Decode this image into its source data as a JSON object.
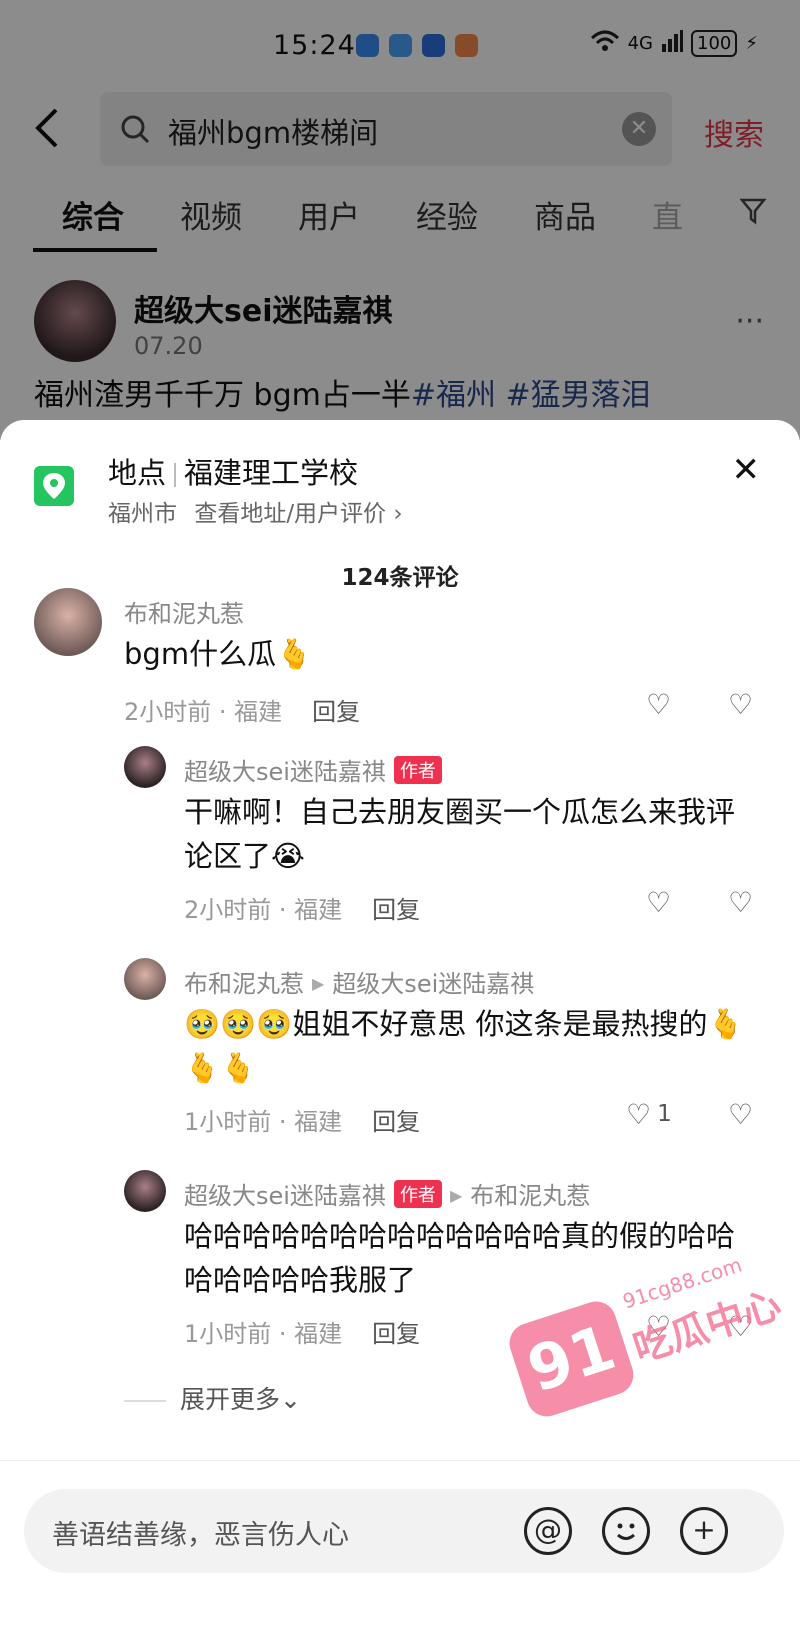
{
  "status_bar": {
    "time": "15:24",
    "network": "4G",
    "battery": "100"
  },
  "search": {
    "query": "福州bgm楼梯间",
    "submit_label": "搜索"
  },
  "tabs": [
    "综合",
    "视频",
    "用户",
    "经验",
    "商品",
    "直"
  ],
  "post": {
    "author": "超级大sei迷陆嘉祺",
    "date": "07.20",
    "text": "福州渣男千千万 bgm占一半",
    "hashtags": "#福州 #猛男落泪"
  },
  "location": {
    "label": "地点",
    "name": "福建理工学校",
    "city": "福州市",
    "link": "查看地址/用户评价 ›"
  },
  "comment_count": "124条评论",
  "comments": [
    {
      "name": "布和泥丸惹",
      "text": "bgm什么瓜🫰",
      "meta": "2小时前 · 福建",
      "reply": "回复"
    },
    {
      "name": "超级大sei迷陆嘉祺",
      "badge": "作者",
      "text": "干嘛啊！自己去朋友圈买一个瓜怎么来我评论区了😭",
      "meta": "2小时前 · 福建",
      "reply": "回复"
    },
    {
      "name": "布和泥丸惹",
      "reply_to": "超级大sei迷陆嘉祺",
      "text": "🥹🥹🥹姐姐不好意思 你这条是最热搜的🫰🫰🫰",
      "meta": "1小时前 · 福建",
      "reply": "回复",
      "likes": "1"
    },
    {
      "name": "超级大sei迷陆嘉祺",
      "badge": "作者",
      "reply_to": "布和泥丸惹",
      "text": "哈哈哈哈哈哈哈哈哈哈哈哈哈真的假的哈哈哈哈哈哈哈我服了",
      "meta": "1小时前 · 福建",
      "reply": "回复"
    }
  ],
  "expand_label": "展开更多⌄",
  "watermark": {
    "number": "91",
    "text": "吃瓜中心",
    "url": "91cg88.com"
  },
  "input": {
    "placeholder": "善语结善缘，恶言伤人心",
    "at_symbol": "@"
  },
  "colors": {
    "accent": "#e8384f",
    "badge": "#f0304f",
    "location": "#24c55e",
    "hashtag": "#2d4a8a"
  }
}
